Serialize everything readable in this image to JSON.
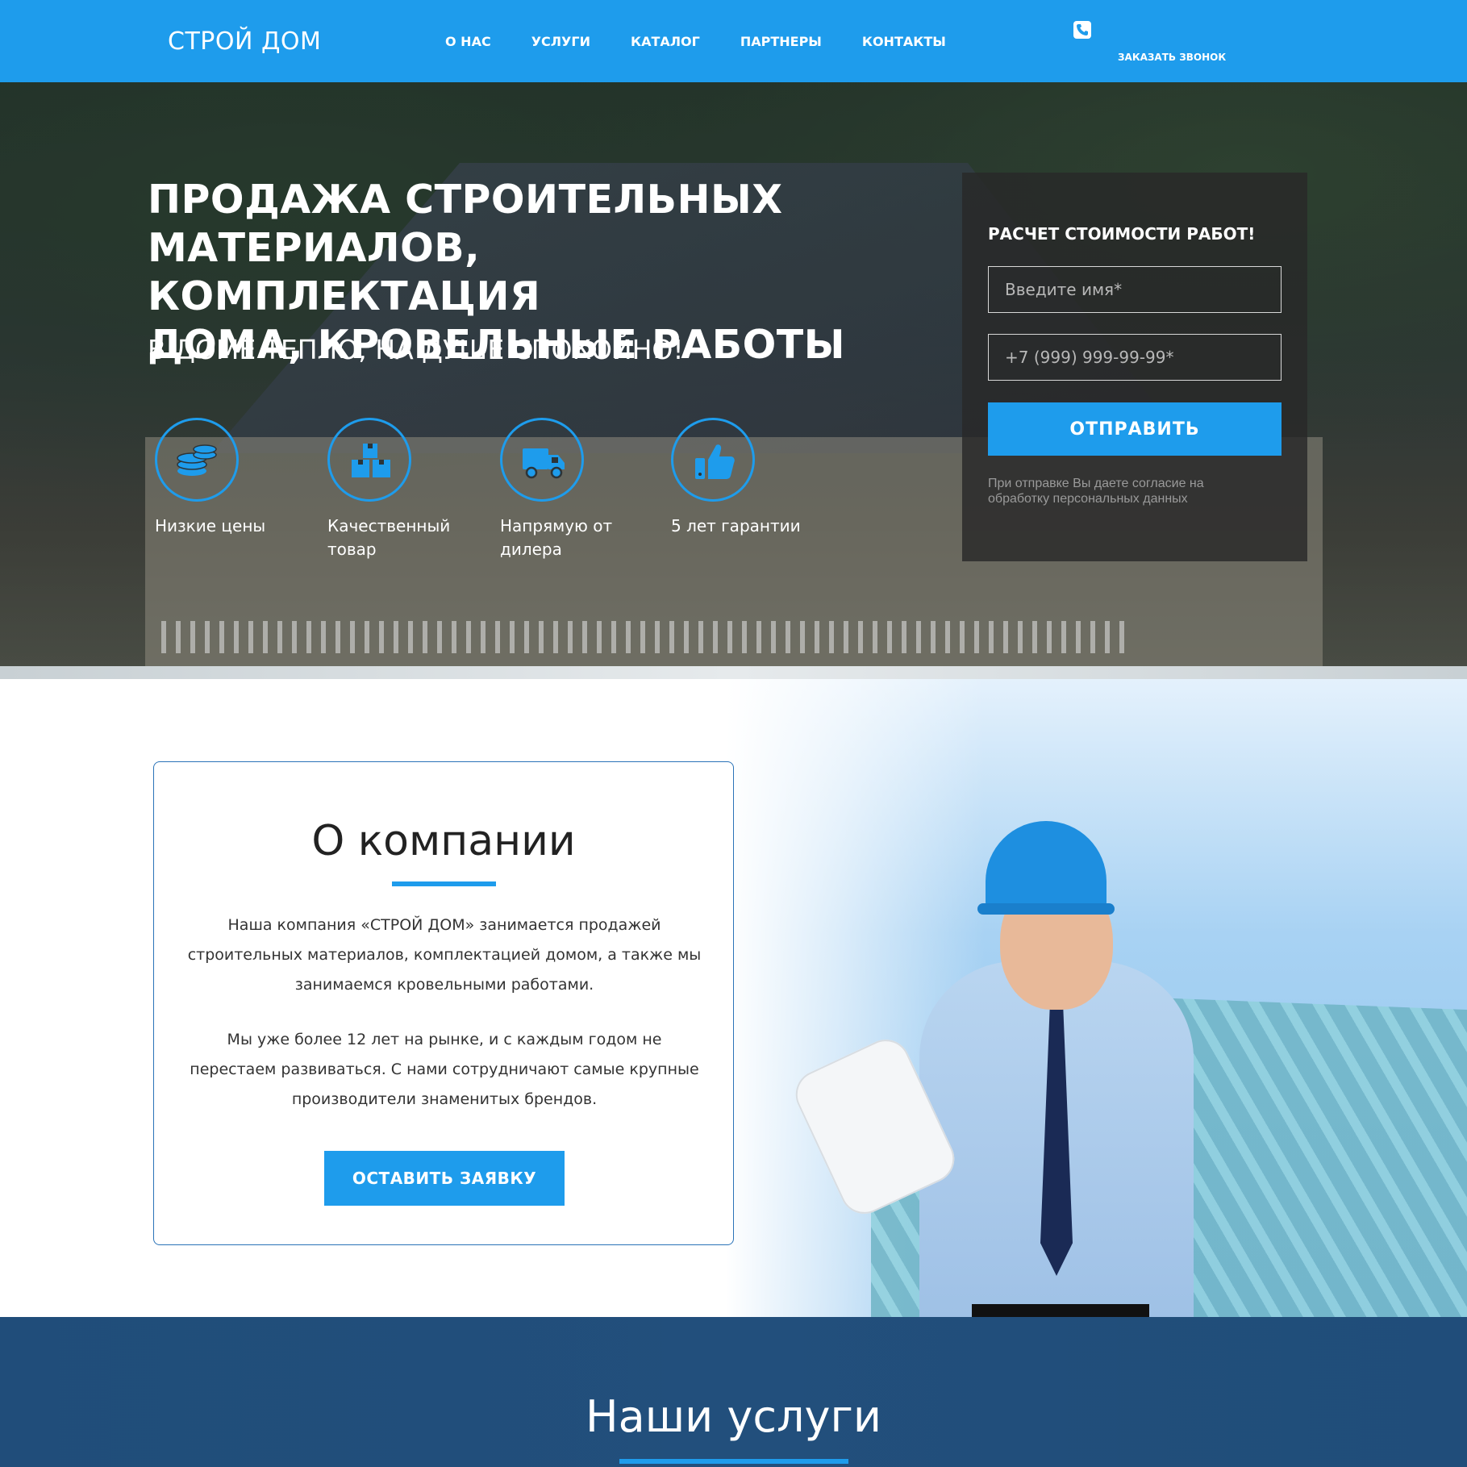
{
  "header": {
    "logo": "СТРОЙ ДОМ",
    "nav": [
      "О НАС",
      "УСЛУГИ",
      "КАТАЛОГ",
      "ПАРТНЕРЫ",
      "КОНТАКТЫ"
    ],
    "call_icon": "phone-icon",
    "call_label": "ЗАКАЗАТЬ ЗВОНОК"
  },
  "hero": {
    "title_lines": [
      "ПРОДАЖА СТРОИТЕЛЬНЫХ",
      "МАТЕРИАЛОВ, КОМПЛЕКТАЦИЯ",
      "ДОМА, КРОВЕЛЬНЫЕ РАБОТЫ"
    ],
    "subtitle": "В ДОМЕ ТЕПЛО, НА ДУШЕ СПОКОЙНО!",
    "features": [
      {
        "icon": "coins-icon",
        "label": "Низкие цены"
      },
      {
        "icon": "boxes-icon",
        "label": "Качественный товар"
      },
      {
        "icon": "truck-icon",
        "label": "Напрямую от дилера"
      },
      {
        "icon": "thumbs-up-icon",
        "label": "5 лет гарантии"
      }
    ]
  },
  "form": {
    "title": "РАСЧЕТ СТОИМОСТИ РАБОТ!",
    "name_placeholder": "Введите имя*",
    "phone_placeholder": "+7 (999) 999-99-99*",
    "submit_label": "ОТПРАВИТЬ",
    "note": "При отправке Вы даете согласие на обработку персональных данных"
  },
  "about": {
    "title": "О компании",
    "paragraph1": "Наша компания «СТРОЙ ДОМ» занимается продажей строительных материалов, комплектацией  домом, а также мы занимаемся кровельными работами.",
    "paragraph2": "Мы уже более 12 лет на рынке, и с каждым годом не перестаем развиваться. С нами сотрудничают самые крупные производители знаменитых брендов.",
    "button_label": "ОСТАВИТЬ ЗАЯВКУ"
  },
  "services": {
    "title": "Наши услуги"
  },
  "colors": {
    "accent": "#1e9cec",
    "header_bg": "#1e9cec",
    "services_bg": "#2a5a86",
    "card_border": "#2a73b8"
  }
}
